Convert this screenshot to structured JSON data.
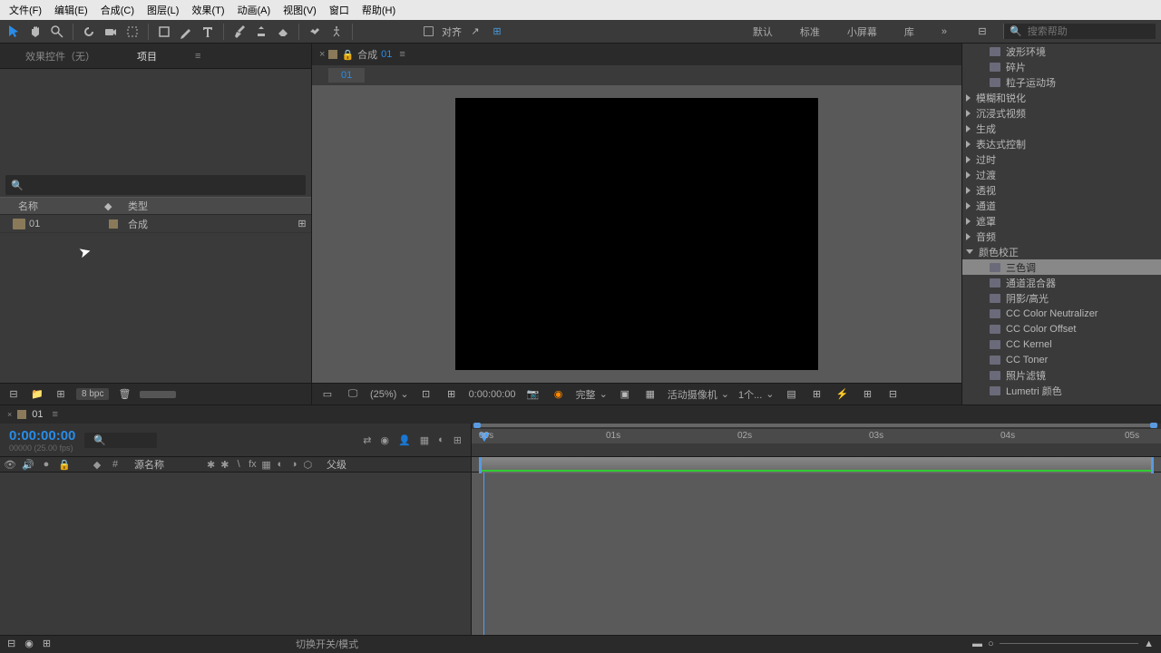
{
  "menu": [
    "文件(F)",
    "编辑(E)",
    "合成(C)",
    "图层(L)",
    "效果(T)",
    "动画(A)",
    "视图(V)",
    "窗口",
    "帮助(H)"
  ],
  "align": "对齐",
  "workspaces": [
    "默认",
    "标准",
    "小屏幕",
    "库"
  ],
  "search_help": "搜索帮助",
  "panel_tabs": {
    "effects": "效果控件（无）",
    "project": "项目"
  },
  "project": {
    "cols": {
      "name": "名称",
      "type": "类型"
    },
    "item": {
      "name": "01",
      "type": "合成"
    },
    "bpc": "8 bpc"
  },
  "comp": {
    "label": "合成",
    "name": "01"
  },
  "viewer": {
    "zoom": "(25%)",
    "time": "0:00:00:00",
    "res": "完整",
    "camera": "活动摄像机",
    "views": "1个..."
  },
  "effects_panel": {
    "top_subs": [
      "波形环境",
      "碎片",
      "粒子运动场"
    ],
    "cats": [
      "模糊和锐化",
      "沉浸式视频",
      "生成",
      "表达式控制",
      "过时",
      "过渡",
      "透视",
      "通道",
      "遮罩",
      "音频"
    ],
    "open_cat": "颜色校正",
    "subs": [
      "三色调",
      "通道混合器",
      "阴影/高光",
      "CC Color Neutralizer",
      "CC Color Offset",
      "CC Kernel",
      "CC Toner",
      "照片滤镜",
      "Lumetri 颜色"
    ]
  },
  "timeline": {
    "name": "01",
    "timecode": "0:00:00:00",
    "sub": "00000 (25.00 fps)",
    "ticks": [
      "00s",
      "01s",
      "02s",
      "03s",
      "04s",
      "05s"
    ],
    "cols": {
      "source": "源名称",
      "parent": "父级"
    },
    "footer": "切换开关/模式"
  }
}
